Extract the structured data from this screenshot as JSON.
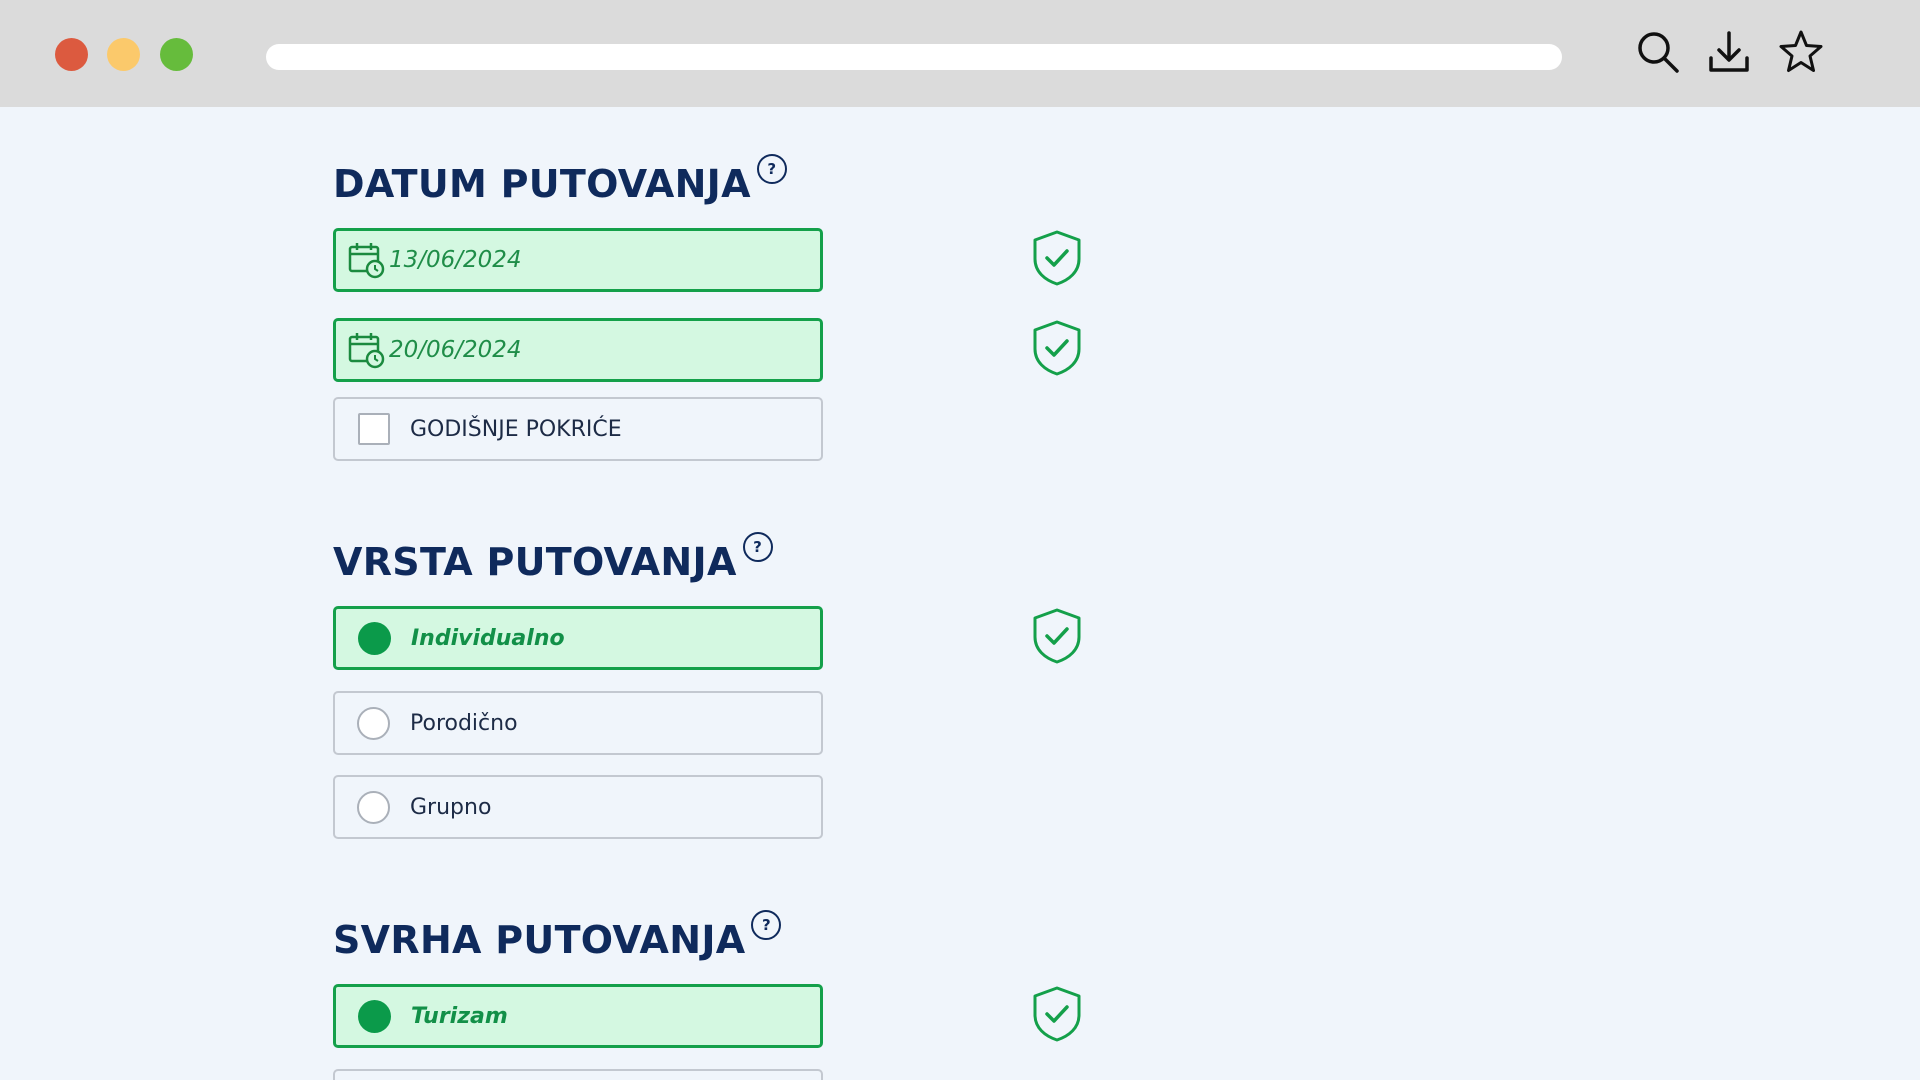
{
  "browser": {
    "icons": [
      "search-icon",
      "download-icon",
      "star-icon"
    ]
  },
  "sections": {
    "datum": {
      "title": "DATUM PUTOVANJA",
      "help": "?",
      "start_date": "13/06/2024",
      "end_date": "20/06/2024",
      "annual_label": "GODIŠNJE POKRIĆE",
      "annual_checked": false
    },
    "vrsta": {
      "title": "VRSTA PUTOVANJA",
      "help": "?",
      "options": [
        "Individualno",
        "Porodično",
        "Grupno"
      ],
      "selected": "Individualno"
    },
    "svrha": {
      "title": "SVRHA PUTOVANJA",
      "help": "?",
      "options": [
        "Turizam"
      ],
      "selected": "Turizam"
    }
  },
  "colors": {
    "heading": "#0f2a5c",
    "accent_green": "#14a04a",
    "active_fill": "#d4f8e1",
    "page_bg": "#f0f5fb"
  }
}
